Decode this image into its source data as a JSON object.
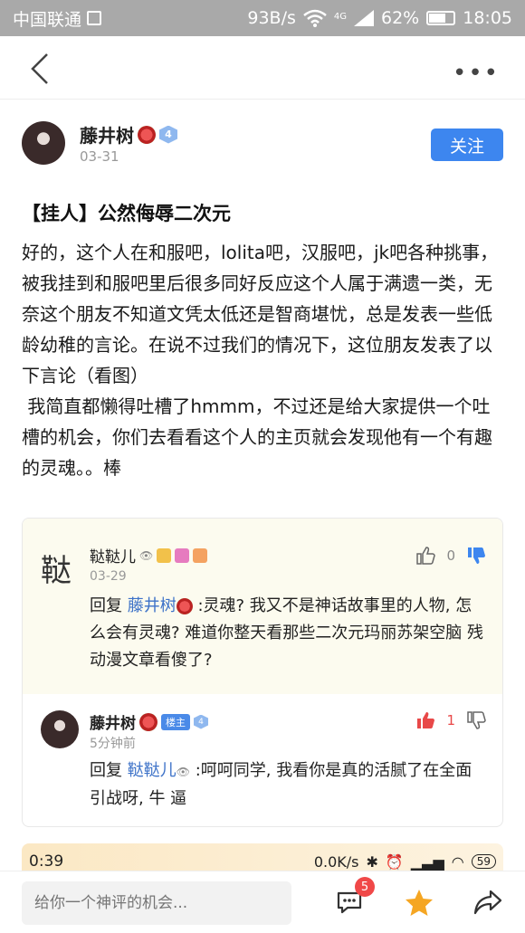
{
  "status_bar": {
    "carrier": "中国联通",
    "speed": "93B/s",
    "network": "4G",
    "battery": "62%",
    "time": "18:05"
  },
  "post": {
    "author": "藤井树",
    "level": "4",
    "date": "03-31",
    "follow_label": "关注",
    "title": "【挂人】公然侮辱二次元",
    "body": "好的，这个人在和服吧，lolita吧，汉服吧，jk吧各种挑事，被我挂到和服吧里后很多同好反应这个人属于满遗一类，无奈这个朋友不知道文凭太低还是智商堪忧，总是发表一些低龄幼稚的言论。在说不过我们的情况下，这位朋友发表了以下言论（看图）\n 我简直都懒得吐槽了hmmm，不过还是给大家提供一个吐槽的机会，你们去看看这个人的主页就会发现他有一个有趣的灵魂。。棒"
  },
  "comments": [
    {
      "avatar_char": "鞑",
      "author": "鞑鞑儿",
      "date": "03-29",
      "reply_prefix": "回复 ",
      "reply_to": "藤井树",
      "text": " :灵魂? 我又不是神话故事里的人物, 怎么会有灵魂? 难道你整天看那些二次元玛丽苏架空脑 残动漫文章看傻了?",
      "likes": "0"
    },
    {
      "author": "藤井树",
      "owner_tag": "楼主",
      "level": "4",
      "date": "5分钟前",
      "reply_prefix": "回复 ",
      "reply_to": "鞑鞑儿",
      "text": " :呵呵同学, 我看你是真的活腻了在全面引战呀, 牛 逼",
      "likes": "1"
    }
  ],
  "embedded_status": {
    "time": "0:39",
    "speed": "0.0K/s",
    "battery": "59"
  },
  "bottom_bar": {
    "input_placeholder": "给你一个神评的机会...",
    "comment_count": "5"
  },
  "colors": {
    "accent": "#3d86ef",
    "mention": "#3d72c8",
    "like_active": "#e84848",
    "badge": "#f04848",
    "star": "#f5a623"
  }
}
